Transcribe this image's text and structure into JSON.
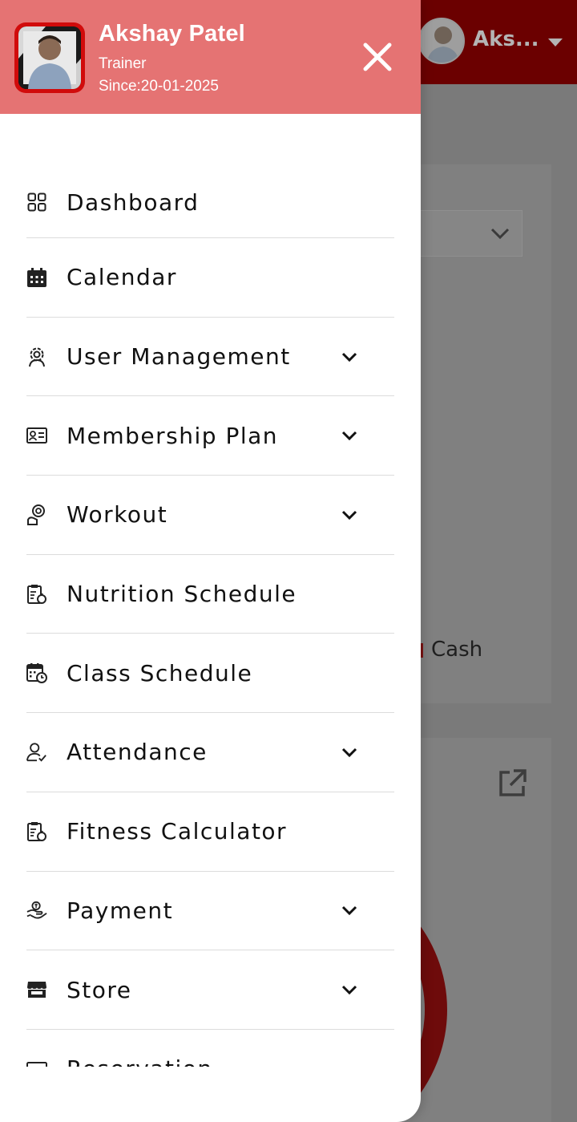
{
  "background": {
    "header_user_name": "Aks...",
    "legend_cash": "Cash"
  },
  "drawer": {
    "user": {
      "name": "Akshay Patel",
      "role": "Trainer",
      "since": "Since:20-01-2025"
    },
    "menu": [
      {
        "label": "Dashboard",
        "icon": "dashboard-grid-icon",
        "has_submenu": false
      },
      {
        "label": "Calendar",
        "icon": "calendar-icon",
        "has_submenu": false
      },
      {
        "label": "User Management",
        "icon": "user-management-icon",
        "has_submenu": true
      },
      {
        "label": "Membership Plan",
        "icon": "membership-card-icon",
        "has_submenu": true
      },
      {
        "label": "Workout",
        "icon": "workout-icon",
        "has_submenu": true
      },
      {
        "label": "Nutrition Schedule",
        "icon": "clipboard-apple-icon",
        "has_submenu": false
      },
      {
        "label": "Class Schedule",
        "icon": "calendar-clock-icon",
        "has_submenu": false
      },
      {
        "label": "Attendance",
        "icon": "user-check-icon",
        "has_submenu": true
      },
      {
        "label": "Fitness Calculator",
        "icon": "clipboard-apple-icon",
        "has_submenu": false
      },
      {
        "label": "Payment",
        "icon": "payment-hand-icon",
        "has_submenu": true
      },
      {
        "label": "Store",
        "icon": "store-icon",
        "has_submenu": true
      },
      {
        "label": "Reservation",
        "icon": "reservation-book-icon",
        "has_submenu": false
      }
    ]
  },
  "colors": {
    "drawer_header": "#e57373",
    "app_header": "#6b0000",
    "avatar_frame": "#d10b0b"
  }
}
